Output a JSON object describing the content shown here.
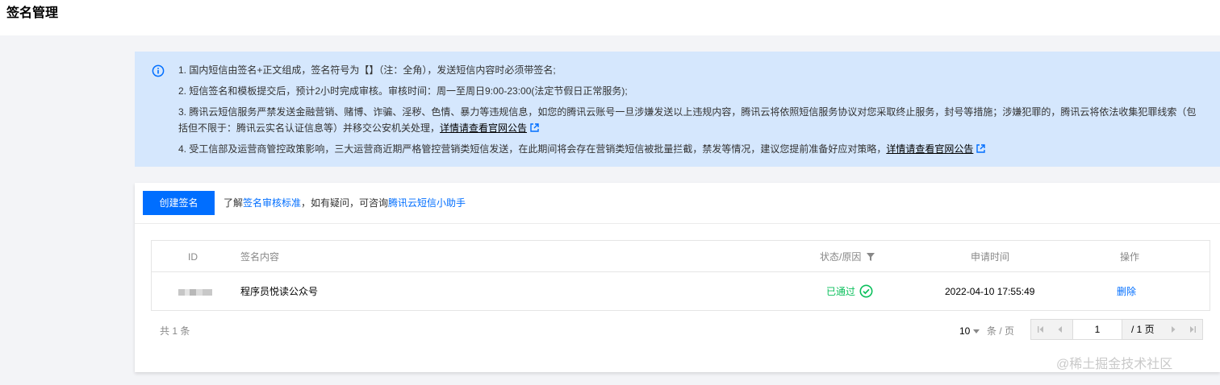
{
  "header": {
    "title": "签名管理"
  },
  "notice": {
    "items": [
      {
        "text": "1. 国内短信由签名+正文组成，签名符号为【】（注：全角），发送短信内容时必须带签名;"
      },
      {
        "text": "2. 短信签名和模板提交后，预计2小时完成审核。审核时间：周一至周日9:00-23:00(法定节假日正常服务);"
      },
      {
        "text_line1": "3. 腾讯云短信服务严禁发送金融营销、赌博、诈骗、淫秽、色情、暴力等违规信息，如您的腾讯云账号一旦涉嫌发送以上违规内容，腾讯云将依照短信服务协议对您采取终止服务，封号等措施；涉嫌犯罪的，腾讯云将依法收集犯罪线索（包",
        "text_line2": "括但不限于：腾讯云实名认证信息等）并移交公安机关处理，",
        "link": "详情请查看官网公告"
      },
      {
        "text": "4. 受工信部及运营商管控政策影响，三大运营商近期严格管控营销类短信发送，在此期间将会存在营销类短信被批量拦截，禁发等情况，建议您提前准备好应对策略，",
        "link": "详情请查看官网公告"
      }
    ]
  },
  "toolbar": {
    "create_label": "创建签名",
    "tip_prefix": "了解",
    "tip_link1": "签名审核标准",
    "tip_middle": "，如有疑问，可咨询",
    "tip_link2": "腾讯云短信小助手"
  },
  "table": {
    "columns": {
      "id": "ID",
      "content": "签名内容",
      "status": "状态/原因",
      "time": "申请时间",
      "actions": "操作"
    },
    "rows": [
      {
        "content": "程序员悦读公众号",
        "status": "已通过",
        "time": "2022-04-10 17:55:49",
        "action": "删除"
      }
    ]
  },
  "pagination": {
    "total": "共 1 条",
    "page_size": "10",
    "page_size_unit": "条 / 页",
    "current_page": "1",
    "total_pages": "/ 1 页"
  },
  "watermark": "@稀土掘金技术社区",
  "colors": {
    "accent": "#006eff",
    "success": "#0abf5b",
    "notice_bg": "#d5e7fd"
  }
}
